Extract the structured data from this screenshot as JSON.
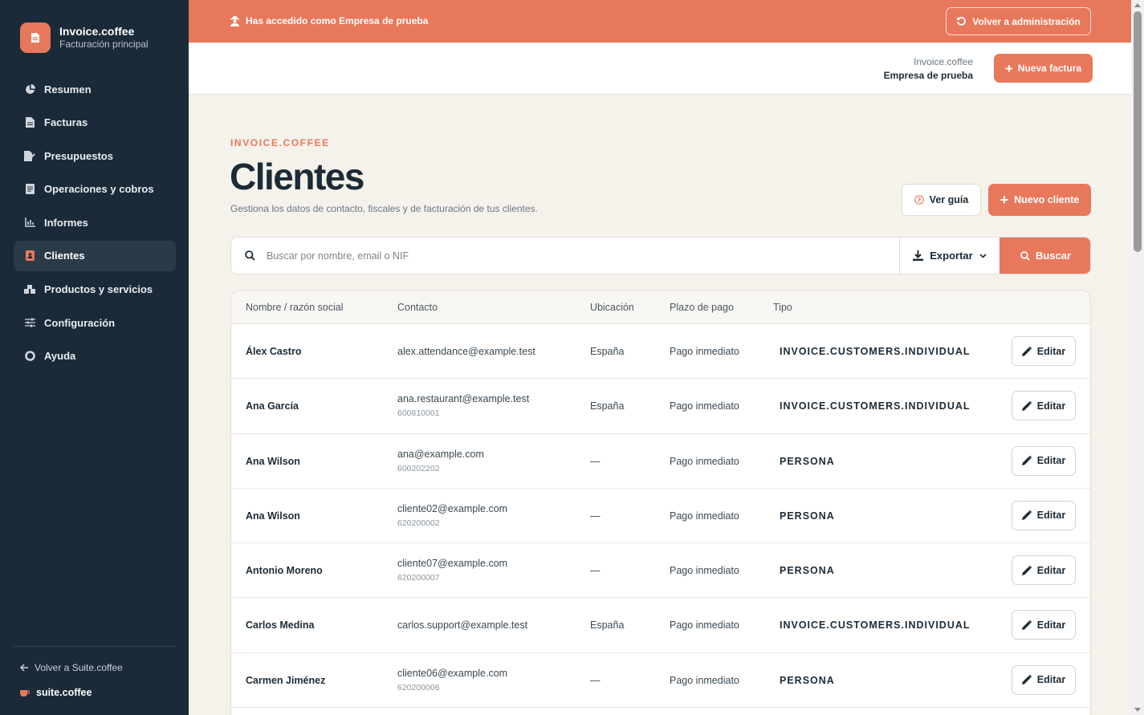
{
  "brand": {
    "title": "Invoice.coffee",
    "subtitle": "Facturación principal"
  },
  "nav": [
    {
      "label": "Resumen",
      "icon": "pie-chart-icon"
    },
    {
      "label": "Facturas",
      "icon": "document-icon"
    },
    {
      "label": "Presupuestos",
      "icon": "file-signature-icon"
    },
    {
      "label": "Operaciones y cobros",
      "icon": "receipt-icon"
    },
    {
      "label": "Informes",
      "icon": "bar-chart-icon"
    },
    {
      "label": "Clientes",
      "icon": "address-book-icon",
      "active": true
    },
    {
      "label": "Productos y servicios",
      "icon": "boxes-icon"
    },
    {
      "label": "Configuración",
      "icon": "sliders-icon"
    },
    {
      "label": "Ayuda",
      "icon": "life-ring-icon"
    }
  ],
  "sidebar_footer": {
    "back_label": "Volver a Suite.coffee",
    "suite_label": "suite.coffee"
  },
  "banner": {
    "text": "Has accedido como Empresa de prueba",
    "button": "Volver a administración"
  },
  "header": {
    "app_name": "Invoice.coffee",
    "company_name": "Empresa de prueba",
    "new_invoice": "Nueva factura"
  },
  "page": {
    "eyebrow": "INVOICE.COFFEE",
    "title": "Clientes",
    "description": "Gestiona los datos de contacto, fiscales y de facturación de tus clientes.",
    "guide_button": "Ver guía",
    "new_client_button": "Nuevo cliente"
  },
  "search": {
    "placeholder": "Buscar por nombre, email o NIF",
    "value": "",
    "export_label": "Exportar",
    "search_label": "Buscar"
  },
  "table": {
    "columns": [
      "Nombre / razón social",
      "Contacto",
      "Ubicación",
      "Plazo de pago",
      "Tipo"
    ],
    "edit_label": "Editar",
    "rows": [
      {
        "name": "Álex Castro",
        "email": "alex.attendance@example.test",
        "phone": "",
        "location": "España",
        "term": "Pago inmediato",
        "type": "INVOICE.CUSTOMERS.INDIVIDUAL"
      },
      {
        "name": "Ana García",
        "email": "ana.restaurant@example.test",
        "phone": "600810001",
        "location": "España",
        "term": "Pago inmediato",
        "type": "INVOICE.CUSTOMERS.INDIVIDUAL"
      },
      {
        "name": "Ana Wilson",
        "email": "ana@example.com",
        "phone": "600202202",
        "location": "—",
        "term": "Pago inmediato",
        "type": "PERSONA"
      },
      {
        "name": "Ana Wilson",
        "email": "cliente02@example.com",
        "phone": "620200002",
        "location": "—",
        "term": "Pago inmediato",
        "type": "PERSONA"
      },
      {
        "name": "Antonio Moreno",
        "email": "cliente07@example.com",
        "phone": "620200007",
        "location": "—",
        "term": "Pago inmediato",
        "type": "PERSONA"
      },
      {
        "name": "Carlos Medina",
        "email": "carlos.support@example.test",
        "phone": "",
        "location": "España",
        "term": "Pago inmediato",
        "type": "INVOICE.CUSTOMERS.INDIVIDUAL"
      },
      {
        "name": "Carmen Jiménez",
        "email": "cliente06@example.com",
        "phone": "620200006",
        "location": "—",
        "term": "Pago inmediato",
        "type": "PERSONA"
      }
    ]
  },
  "colors": {
    "accent": "#e8785c",
    "sidebar": "#1b2a38",
    "background": "#f5f2ec"
  }
}
